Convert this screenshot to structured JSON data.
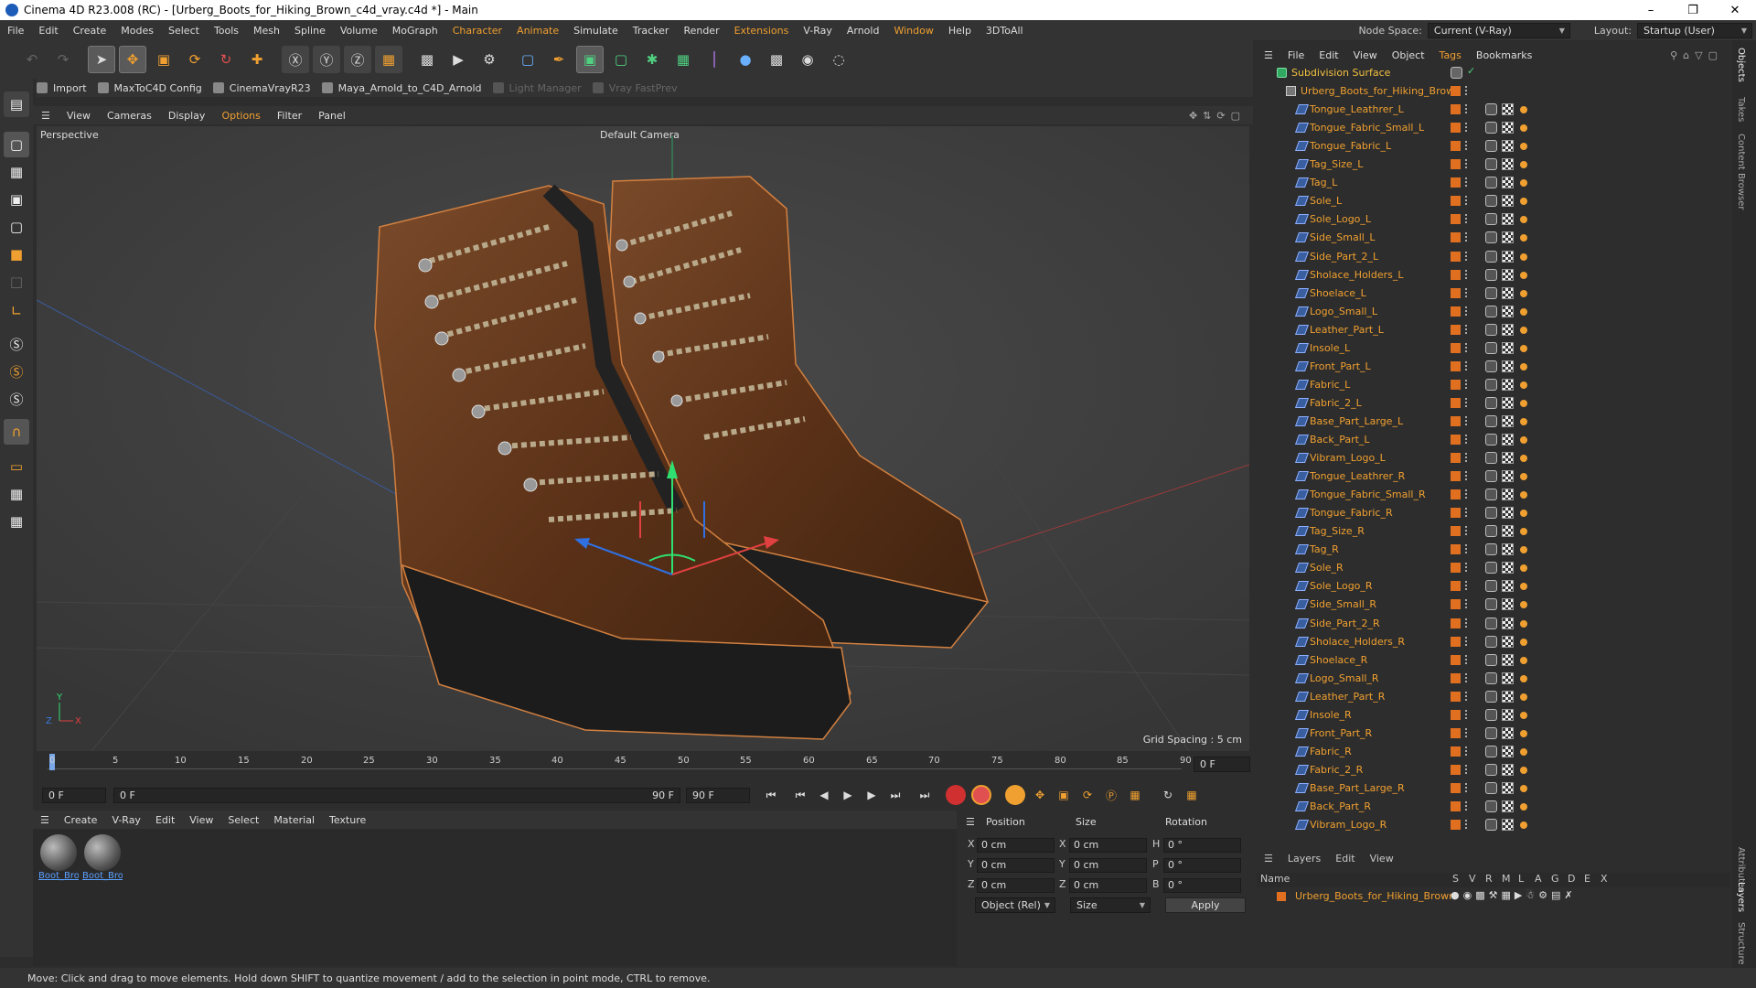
{
  "window": {
    "title": "Cinema 4D R23.008 (RC) - [Urberg_Boots_for_Hiking_Brown_c4d_vray.c4d *] - Main"
  },
  "menu": [
    "File",
    "Edit",
    "Create",
    "Modes",
    "Select",
    "Tools",
    "Mesh",
    "Spline",
    "Volume",
    "MoGraph",
    "Character",
    "Animate",
    "Simulate",
    "Tracker",
    "Render",
    "Extensions",
    "V-Ray",
    "Arnold",
    "Window",
    "Help",
    "3DToAll"
  ],
  "nodespace": {
    "label": "Node Space:",
    "value": "Current (V-Ray)"
  },
  "layout": {
    "label": "Layout:",
    "value": "Startup (User)"
  },
  "scripts": [
    {
      "label": "Import",
      "dim": false
    },
    {
      "label": "MaxToC4D Config",
      "dim": false
    },
    {
      "label": "CinemaVrayR23",
      "dim": false
    },
    {
      "label": "Maya_Arnold_to_C4D_Arnold",
      "dim": false
    },
    {
      "label": "Light Manager",
      "dim": true
    },
    {
      "label": "Vray FastPrev",
      "dim": true
    }
  ],
  "viewport_menu": [
    "View",
    "Cameras",
    "Display",
    "Options",
    "Filter",
    "Panel"
  ],
  "viewport": {
    "name": "Perspective",
    "camera": "Default Camera",
    "grid_spacing": "Grid Spacing : 5 cm"
  },
  "timeline": {
    "ticks": [
      "0",
      "5",
      "10",
      "15",
      "20",
      "25",
      "30",
      "35",
      "40",
      "45",
      "50",
      "55",
      "60",
      "65",
      "70",
      "75",
      "80",
      "85",
      "90"
    ],
    "current_frame": "0 F",
    "start": "0 F",
    "preview_start": "0 F",
    "preview_end": "90 F",
    "end": "90 F"
  },
  "material_menu": [
    "Create",
    "V-Ray",
    "Edit",
    "View",
    "Select",
    "Material",
    "Texture"
  ],
  "materials": [
    "Boot_Bro",
    "Boot_Bro"
  ],
  "attributes": {
    "headers": [
      "Position",
      "Size",
      "Rotation"
    ],
    "rows": [
      {
        "axis": "X",
        "pos": "0 cm",
        "saxis": "X",
        "size": "0 cm",
        "raxis": "H",
        "rot": "0 °"
      },
      {
        "axis": "Y",
        "pos": "0 cm",
        "saxis": "Y",
        "size": "0 cm",
        "raxis": "P",
        "rot": "0 °"
      },
      {
        "axis": "Z",
        "pos": "0 cm",
        "saxis": "Z",
        "size": "0 cm",
        "raxis": "B",
        "rot": "0 °"
      }
    ],
    "mode": "Object (Rel)",
    "size_mode": "Size",
    "apply": "Apply"
  },
  "status": "Move: Click and drag to move elements. Hold down SHIFT to quantize movement / add to the selection in point mode, CTRL to remove.",
  "object_menu": [
    "File",
    "Edit",
    "View",
    "Object",
    "Tags",
    "Bookmarks"
  ],
  "objects": {
    "root": "Subdivision Surface",
    "group": "Urberg_Boots_for_Hiking_Brown",
    "children": [
      "Tongue_Leathrer_L",
      "Tongue_Fabric_Small_L",
      "Tongue_Fabric_L",
      "Tag_Size_L",
      "Tag_L",
      "Sole_L",
      "Sole_Logo_L",
      "Side_Small_L",
      "Side_Part_2_L",
      "Sholace_Holders_L",
      "Shoelace_L",
      "Logo_Small_L",
      "Leather_Part_L",
      "Insole_L",
      "Front_Part_L",
      "Fabric_L",
      "Fabric_2_L",
      "Base_Part_Large_L",
      "Back_Part_L",
      "Vibram_Logo_L",
      "Tongue_Leathrer_R",
      "Tongue_Fabric_Small_R",
      "Tongue_Fabric_R",
      "Tag_Size_R",
      "Tag_R",
      "Sole_R",
      "Sole_Logo_R",
      "Side_Small_R",
      "Side_Part_2_R",
      "Sholace_Holders_R",
      "Shoelace_R",
      "Logo_Small_R",
      "Leather_Part_R",
      "Insole_R",
      "Front_Part_R",
      "Fabric_R",
      "Fabric_2_R",
      "Base_Part_Large_R",
      "Back_Part_R",
      "Vibram_Logo_R"
    ]
  },
  "layers": {
    "menu": [
      "Layers",
      "Edit",
      "View"
    ],
    "name_header": "Name",
    "cols": [
      "S",
      "V",
      "R",
      "M",
      "L",
      "A",
      "G",
      "D",
      "E",
      "X"
    ],
    "items": [
      "Urberg_Boots_for_Hiking_Brown"
    ]
  },
  "right_tabs": [
    "Objects",
    "Takes",
    "Content Browser",
    "Attributes",
    "Layers",
    "Structure"
  ],
  "colors": {
    "accent": "#f0a030",
    "layer": "#e07020",
    "link": "#5aa0ff"
  }
}
